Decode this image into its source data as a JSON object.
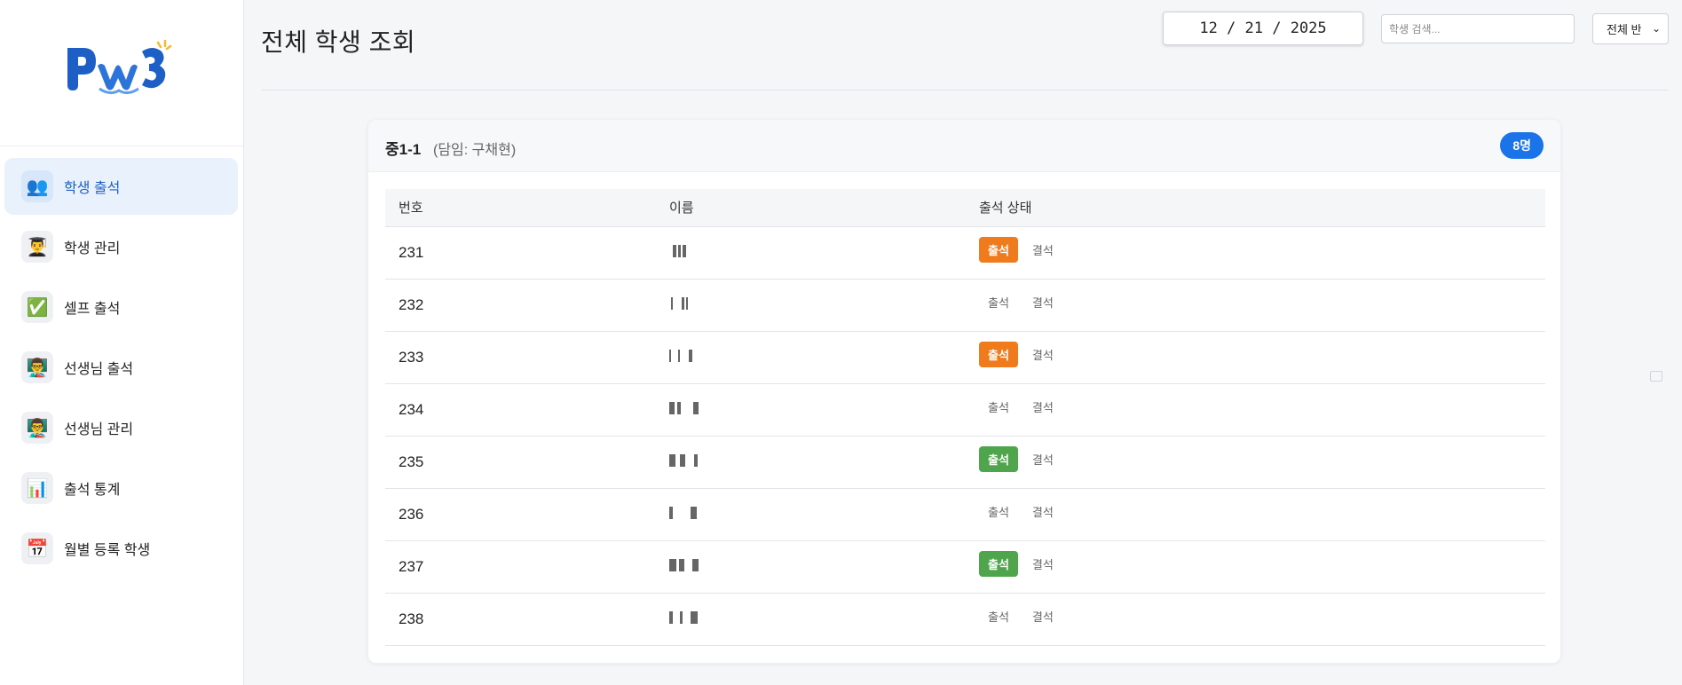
{
  "sidebar": {
    "logo_text": "PW3",
    "items": [
      {
        "label": "학생 출석",
        "icon": "students-icon",
        "glyph": "👥",
        "active": true
      },
      {
        "label": "학생 관리",
        "icon": "student-manage-icon",
        "glyph": "👨‍🎓",
        "active": false
      },
      {
        "label": "셀프 출석",
        "icon": "checkmark-icon",
        "glyph": "✅",
        "active": false
      },
      {
        "label": "선생님 출석",
        "icon": "teacher-icon",
        "glyph": "👨‍🏫",
        "active": false
      },
      {
        "label": "선생님 관리",
        "icon": "teacher-manage-icon",
        "glyph": "👨‍🏫",
        "active": false
      },
      {
        "label": "출석 통계",
        "icon": "chart-icon",
        "glyph": "📊",
        "active": false
      },
      {
        "label": "월별 등록 학생",
        "icon": "calendar-icon",
        "glyph": "📅",
        "active": false
      }
    ]
  },
  "header": {
    "title": "전체 학생 조회",
    "date_value": "12 / 21 / 2025",
    "search_placeholder": "학생 검색...",
    "class_select": "전체 반"
  },
  "card": {
    "class_name": "중1-1",
    "teacher": "(담임: 구채현)",
    "count": "8명",
    "columns": [
      "번호",
      "이름",
      "출석 상태"
    ],
    "present_label": "출석",
    "absent_label": "결석",
    "rows": [
      {
        "number": "231",
        "status": "present-orange"
      },
      {
        "number": "232",
        "status": "none"
      },
      {
        "number": "233",
        "status": "present-orange"
      },
      {
        "number": "234",
        "status": "none"
      },
      {
        "number": "235",
        "status": "present-green"
      },
      {
        "number": "236",
        "status": "none"
      },
      {
        "number": "237",
        "status": "present-green"
      },
      {
        "number": "238",
        "status": "none"
      }
    ]
  },
  "colors": {
    "accent": "#1a73e8",
    "present_orange": "#f07b1d",
    "present_green": "#4fa54b"
  }
}
